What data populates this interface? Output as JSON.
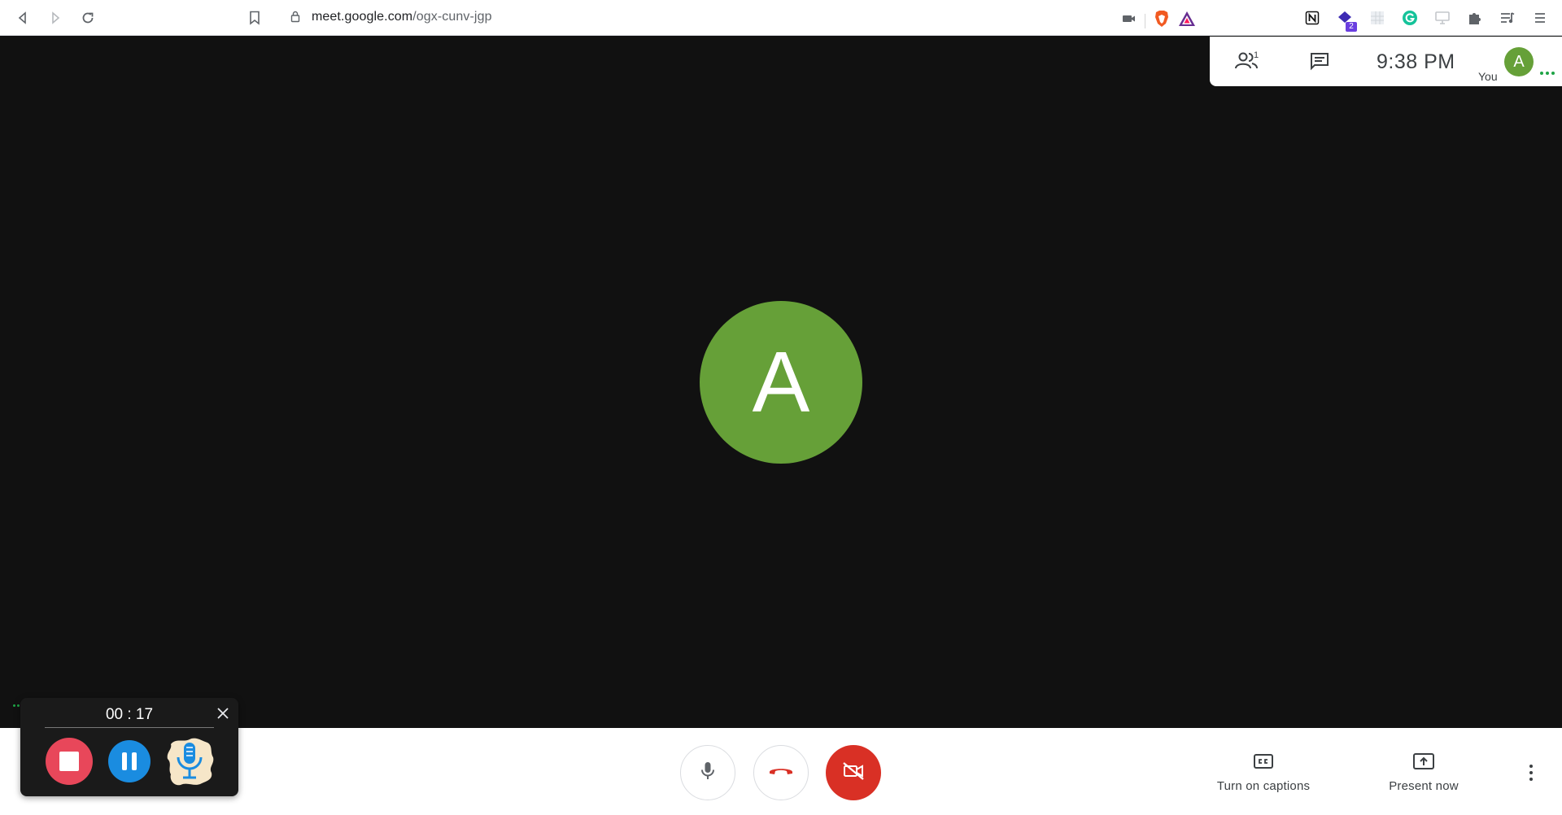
{
  "browser": {
    "url_host": "meet.google.com",
    "url_path": "/ogx-cunv-jgp",
    "icons": [
      "back-icon",
      "forward-icon",
      "reload-icon",
      "bookmark-icon",
      "lock-icon",
      "camera-icon",
      "brave-shield-icon",
      "brave-rewards-icon"
    ],
    "extensions": [
      {
        "name": "notion-icon"
      },
      {
        "name": "extension-badge-icon",
        "badge": "2"
      },
      {
        "name": "extension-grid-icon"
      },
      {
        "name": "grammarly-icon"
      },
      {
        "name": "screen-icon"
      },
      {
        "name": "puzzle-icon"
      },
      {
        "name": "media-queue-icon"
      },
      {
        "name": "menu-icon"
      }
    ]
  },
  "meet_panel": {
    "people_count": "1",
    "time": "9:38  PM",
    "self_label": "You",
    "self_initial": "A"
  },
  "main": {
    "participant_initial": "A"
  },
  "controls": {
    "mic_icon": "mic-icon",
    "hangup_icon": "hangup-icon",
    "camera_off_icon": "camera-off-icon",
    "captions_label": "Turn on captions",
    "present_label": "Present now"
  },
  "recorder": {
    "elapsed": "00 : 17"
  },
  "colors": {
    "avatar_green": "#66a038",
    "meet_red": "#d93025",
    "rec_stop": "#e8475a",
    "rec_pause": "#1a8ce0",
    "background": "#111111"
  }
}
